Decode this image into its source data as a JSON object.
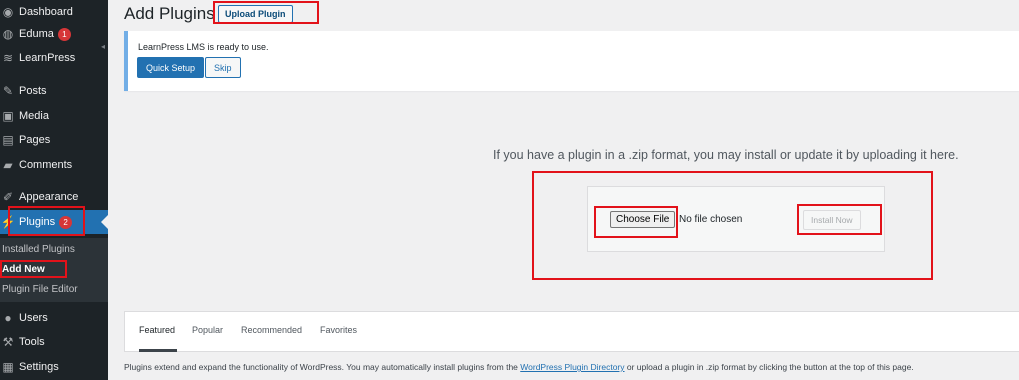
{
  "sidebar": {
    "items": [
      {
        "label": "Dashboard",
        "icon": "dashboard-icon",
        "glyph": "◉"
      },
      {
        "label": "Eduma",
        "icon": "eduma-icon",
        "glyph": "◍",
        "badge": "1"
      },
      {
        "label": "LearnPress",
        "icon": "learnpress-icon",
        "glyph": "≋"
      },
      {
        "label": "Posts",
        "icon": "pin-icon",
        "glyph": "✎"
      },
      {
        "label": "Media",
        "icon": "media-icon",
        "glyph": "▣"
      },
      {
        "label": "Pages",
        "icon": "pages-icon",
        "glyph": "▤"
      },
      {
        "label": "Comments",
        "icon": "comments-icon",
        "glyph": "▰"
      },
      {
        "label": "Appearance",
        "icon": "brush-icon",
        "glyph": "✐"
      },
      {
        "label": "Plugins",
        "icon": "plugin-icon",
        "glyph": "⚡",
        "badge": "2"
      },
      {
        "label": "Users",
        "icon": "users-icon",
        "glyph": "●"
      },
      {
        "label": "Tools",
        "icon": "wrench-icon",
        "glyph": "⚒"
      },
      {
        "label": "Settings",
        "icon": "settings-icon",
        "glyph": "▦"
      }
    ],
    "submenu": [
      "Installed Plugins",
      "Add New",
      "Plugin File Editor"
    ]
  },
  "header": {
    "title": "Add Plugins",
    "upload_button": "Upload Plugin"
  },
  "notice": {
    "text": "LearnPress LMS is ready to use.",
    "quick_setup": "Quick Setup",
    "skip": "Skip"
  },
  "upload": {
    "description": "If you have a plugin in a .zip format, you may install or update it by uploading it here.",
    "choose_file": "Choose File",
    "no_file": "No file chosen",
    "install_now": "Install Now"
  },
  "tabs": [
    "Featured",
    "Popular",
    "Recommended",
    "Favorites"
  ],
  "footer": {
    "before": "Plugins extend and expand the functionality of WordPress. You may automatically install plugins from the ",
    "link": "WordPress Plugin Directory",
    "after": " or upload a plugin in .zip format by clicking the button at the top of this page."
  },
  "colors": {
    "sidebar_bg": "#1d2327",
    "accent": "#2271b1",
    "annotation_red": "#e2121a",
    "badge_red": "#d63638"
  }
}
